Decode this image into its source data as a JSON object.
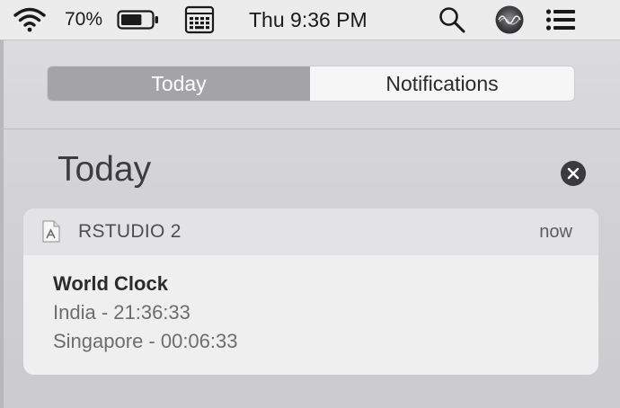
{
  "menubar": {
    "battery_percent": "70%",
    "battery_level": 0.7,
    "clock": "Thu 9:36 PM",
    "icons": [
      "wifi-icon",
      "battery-icon",
      "keyboard-viewer-icon",
      "search-icon",
      "siri-icon",
      "notification-center-icon"
    ]
  },
  "segmented": {
    "today_label": "Today",
    "notifications_label": "Notifications",
    "selected": "Today"
  },
  "section": {
    "title": "Today"
  },
  "widget": {
    "app_name": "RSTUDIO 2",
    "time": "now",
    "title": "World Clock",
    "lines": [
      "India - 21:36:33",
      "Singapore - 00:06:33"
    ]
  }
}
